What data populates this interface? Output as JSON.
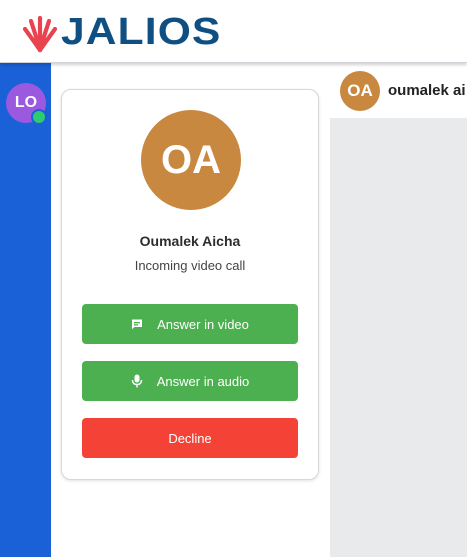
{
  "brand": {
    "logo_text": "JALIOS",
    "logo_icon": "jalios-fan-icon",
    "primary_color": "#0f4f82",
    "accent_color": "#e8434f"
  },
  "sidebar": {
    "background": "#1a60d6",
    "user": {
      "initials": "LO",
      "avatar_color": "#9b59e0",
      "presence_color": "#2ecc71"
    }
  },
  "conversation": {
    "avatar_initials": "OA",
    "avatar_color": "#c98840",
    "name": "oumalek ai"
  },
  "call": {
    "caller_initials": "OA",
    "caller_avatar_color": "#c98840",
    "caller_name": "Oumalek Aicha",
    "status_text": "Incoming video call",
    "answer_video_label": "Answer in video",
    "answer_video_icon": "chat-bubble-icon",
    "answer_audio_label": "Answer in audio",
    "answer_audio_icon": "microphone-icon",
    "decline_label": "Decline",
    "answer_color": "#4caf50",
    "decline_color": "#f44336"
  }
}
